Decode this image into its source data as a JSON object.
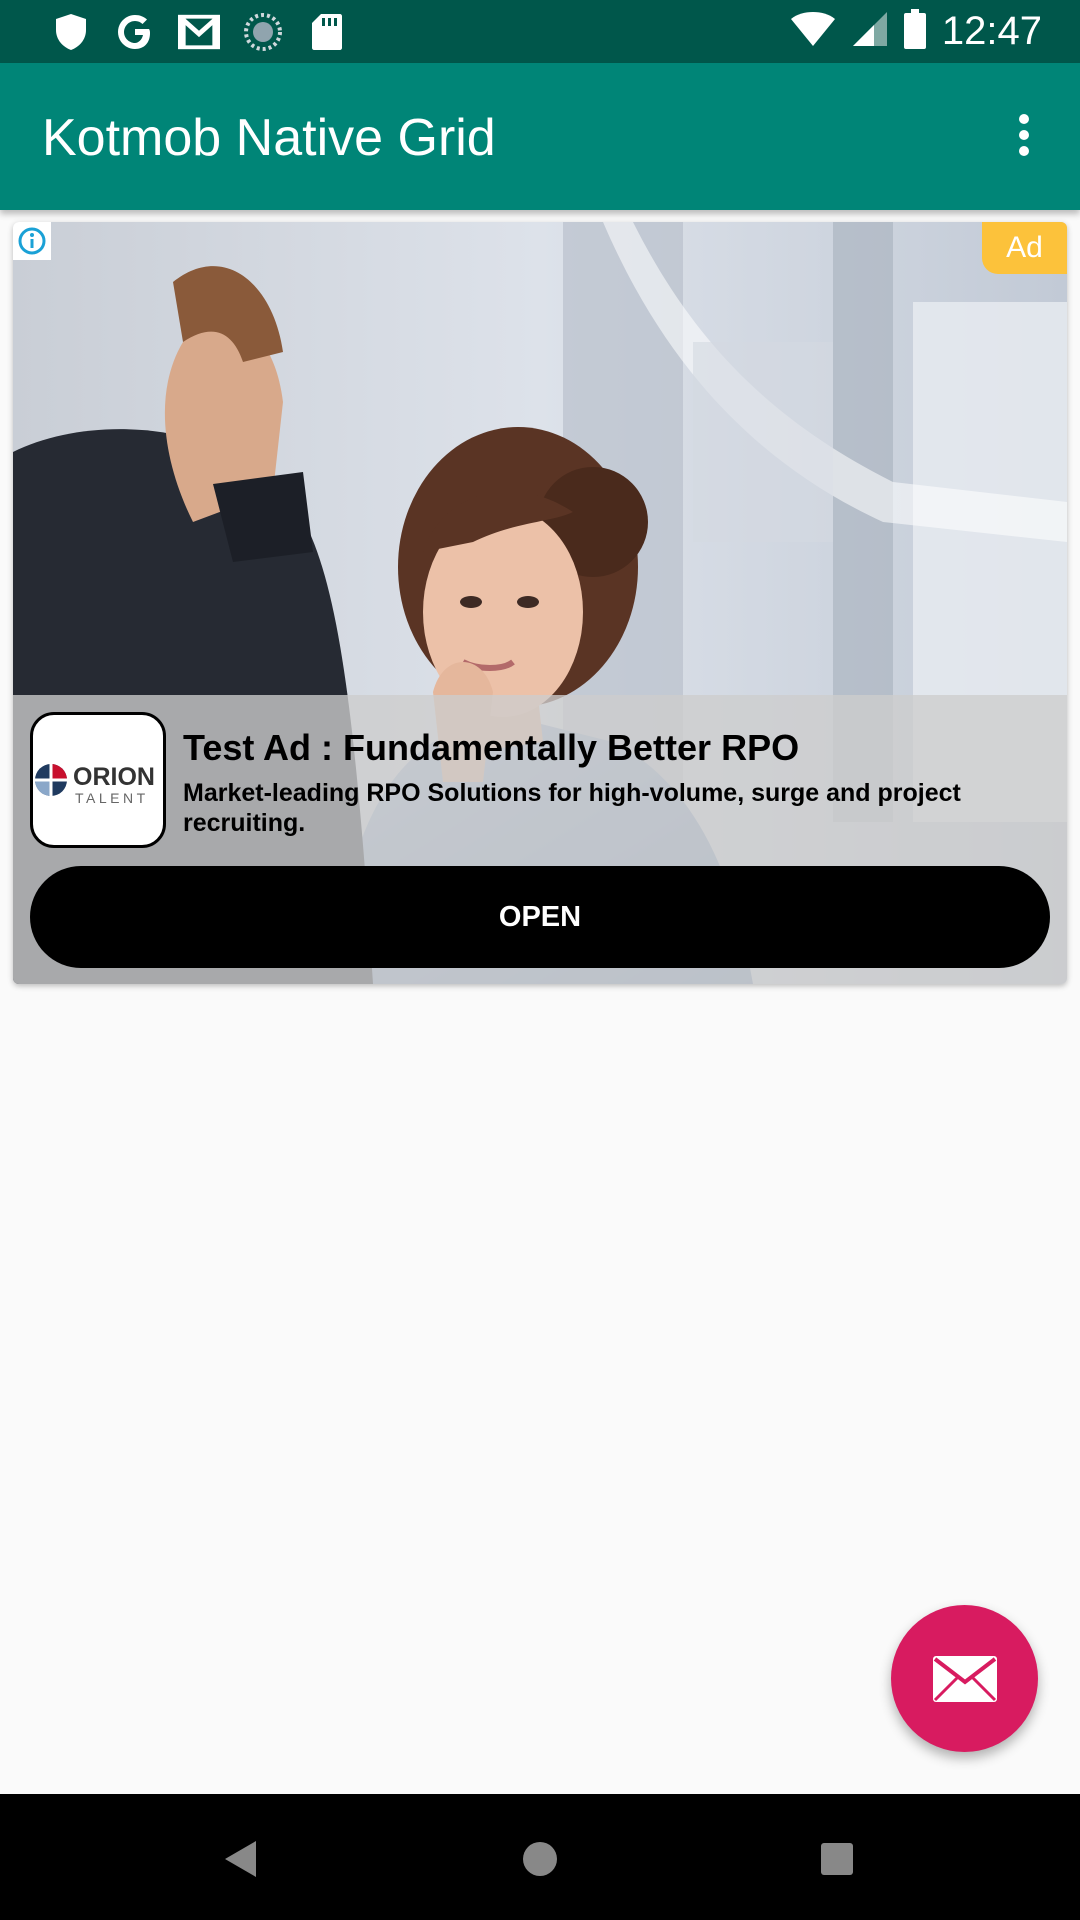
{
  "status_bar": {
    "time": "12:47",
    "left_icons": [
      "shield-icon",
      "google-icon",
      "gmail-icon",
      "sync-icon",
      "sd-card-icon"
    ],
    "right_icons": [
      "wifi-icon",
      "cell-signal-icon",
      "battery-icon"
    ]
  },
  "app_bar": {
    "title": "Kotmob Native Grid",
    "menu_icon": "more-vert-icon",
    "color": "#008577"
  },
  "ad": {
    "badge": "Ad",
    "info_icon": "info-icon",
    "logo": {
      "line1": "ORION",
      "line2": "TALENT"
    },
    "headline": "Test Ad : Fundamentally Better RPO",
    "body": "Market-leading RPO Solutions for high-volume, surge and project recruiting.",
    "cta": "OPEN",
    "badge_color": "#fcc23b"
  },
  "fab": {
    "icon": "mail-icon",
    "color": "#d81b60"
  },
  "nav_bar": {
    "buttons": [
      "back-icon",
      "home-icon",
      "recents-icon"
    ]
  }
}
